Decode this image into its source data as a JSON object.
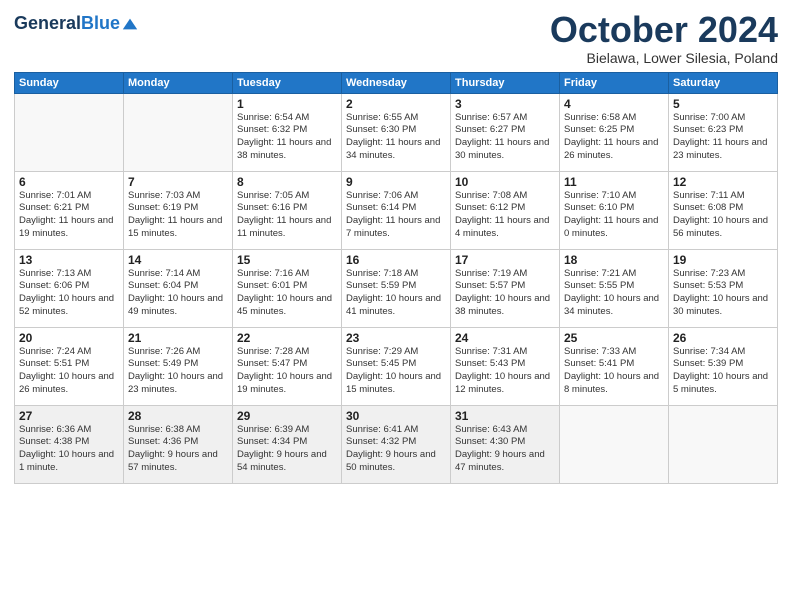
{
  "header": {
    "logo_line1": "General",
    "logo_line2": "Blue",
    "month": "October 2024",
    "location": "Bielawa, Lower Silesia, Poland"
  },
  "weekdays": [
    "Sunday",
    "Monday",
    "Tuesday",
    "Wednesday",
    "Thursday",
    "Friday",
    "Saturday"
  ],
  "weeks": [
    [
      {
        "day": "",
        "info": ""
      },
      {
        "day": "",
        "info": ""
      },
      {
        "day": "1",
        "info": "Sunrise: 6:54 AM\nSunset: 6:32 PM\nDaylight: 11 hours and 38 minutes."
      },
      {
        "day": "2",
        "info": "Sunrise: 6:55 AM\nSunset: 6:30 PM\nDaylight: 11 hours and 34 minutes."
      },
      {
        "day": "3",
        "info": "Sunrise: 6:57 AM\nSunset: 6:27 PM\nDaylight: 11 hours and 30 minutes."
      },
      {
        "day": "4",
        "info": "Sunrise: 6:58 AM\nSunset: 6:25 PM\nDaylight: 11 hours and 26 minutes."
      },
      {
        "day": "5",
        "info": "Sunrise: 7:00 AM\nSunset: 6:23 PM\nDaylight: 11 hours and 23 minutes."
      }
    ],
    [
      {
        "day": "6",
        "info": "Sunrise: 7:01 AM\nSunset: 6:21 PM\nDaylight: 11 hours and 19 minutes."
      },
      {
        "day": "7",
        "info": "Sunrise: 7:03 AM\nSunset: 6:19 PM\nDaylight: 11 hours and 15 minutes."
      },
      {
        "day": "8",
        "info": "Sunrise: 7:05 AM\nSunset: 6:16 PM\nDaylight: 11 hours and 11 minutes."
      },
      {
        "day": "9",
        "info": "Sunrise: 7:06 AM\nSunset: 6:14 PM\nDaylight: 11 hours and 7 minutes."
      },
      {
        "day": "10",
        "info": "Sunrise: 7:08 AM\nSunset: 6:12 PM\nDaylight: 11 hours and 4 minutes."
      },
      {
        "day": "11",
        "info": "Sunrise: 7:10 AM\nSunset: 6:10 PM\nDaylight: 11 hours and 0 minutes."
      },
      {
        "day": "12",
        "info": "Sunrise: 7:11 AM\nSunset: 6:08 PM\nDaylight: 10 hours and 56 minutes."
      }
    ],
    [
      {
        "day": "13",
        "info": "Sunrise: 7:13 AM\nSunset: 6:06 PM\nDaylight: 10 hours and 52 minutes."
      },
      {
        "day": "14",
        "info": "Sunrise: 7:14 AM\nSunset: 6:04 PM\nDaylight: 10 hours and 49 minutes."
      },
      {
        "day": "15",
        "info": "Sunrise: 7:16 AM\nSunset: 6:01 PM\nDaylight: 10 hours and 45 minutes."
      },
      {
        "day": "16",
        "info": "Sunrise: 7:18 AM\nSunset: 5:59 PM\nDaylight: 10 hours and 41 minutes."
      },
      {
        "day": "17",
        "info": "Sunrise: 7:19 AM\nSunset: 5:57 PM\nDaylight: 10 hours and 38 minutes."
      },
      {
        "day": "18",
        "info": "Sunrise: 7:21 AM\nSunset: 5:55 PM\nDaylight: 10 hours and 34 minutes."
      },
      {
        "day": "19",
        "info": "Sunrise: 7:23 AM\nSunset: 5:53 PM\nDaylight: 10 hours and 30 minutes."
      }
    ],
    [
      {
        "day": "20",
        "info": "Sunrise: 7:24 AM\nSunset: 5:51 PM\nDaylight: 10 hours and 26 minutes."
      },
      {
        "day": "21",
        "info": "Sunrise: 7:26 AM\nSunset: 5:49 PM\nDaylight: 10 hours and 23 minutes."
      },
      {
        "day": "22",
        "info": "Sunrise: 7:28 AM\nSunset: 5:47 PM\nDaylight: 10 hours and 19 minutes."
      },
      {
        "day": "23",
        "info": "Sunrise: 7:29 AM\nSunset: 5:45 PM\nDaylight: 10 hours and 15 minutes."
      },
      {
        "day": "24",
        "info": "Sunrise: 7:31 AM\nSunset: 5:43 PM\nDaylight: 10 hours and 12 minutes."
      },
      {
        "day": "25",
        "info": "Sunrise: 7:33 AM\nSunset: 5:41 PM\nDaylight: 10 hours and 8 minutes."
      },
      {
        "day": "26",
        "info": "Sunrise: 7:34 AM\nSunset: 5:39 PM\nDaylight: 10 hours and 5 minutes."
      }
    ],
    [
      {
        "day": "27",
        "info": "Sunrise: 6:36 AM\nSunset: 4:38 PM\nDaylight: 10 hours and 1 minute."
      },
      {
        "day": "28",
        "info": "Sunrise: 6:38 AM\nSunset: 4:36 PM\nDaylight: 9 hours and 57 minutes."
      },
      {
        "day": "29",
        "info": "Sunrise: 6:39 AM\nSunset: 4:34 PM\nDaylight: 9 hours and 54 minutes."
      },
      {
        "day": "30",
        "info": "Sunrise: 6:41 AM\nSunset: 4:32 PM\nDaylight: 9 hours and 50 minutes."
      },
      {
        "day": "31",
        "info": "Sunrise: 6:43 AM\nSunset: 4:30 PM\nDaylight: 9 hours and 47 minutes."
      },
      {
        "day": "",
        "info": ""
      },
      {
        "day": "",
        "info": ""
      }
    ]
  ]
}
